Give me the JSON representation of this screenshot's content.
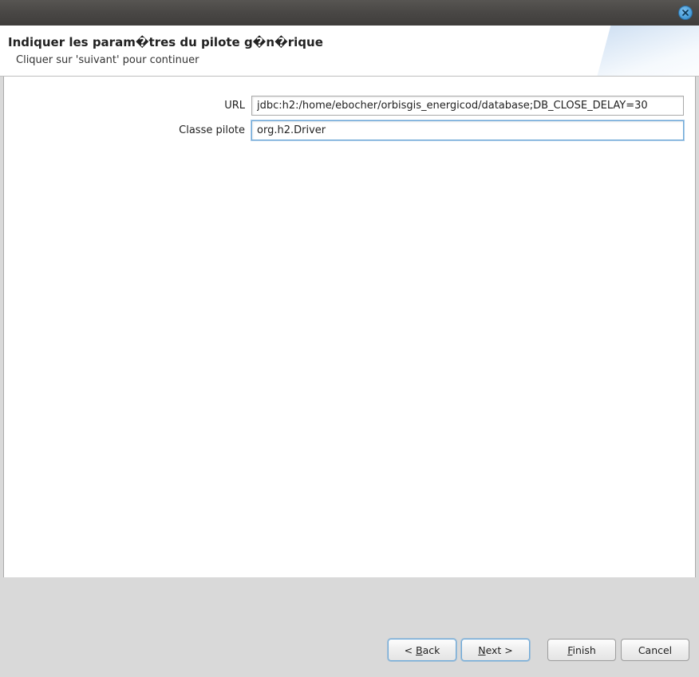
{
  "header": {
    "title": "Indiquer les param�tres du pilote g�n�rique",
    "subtitle": "Cliquer sur 'suivant' pour continuer"
  },
  "form": {
    "url_label": "URL",
    "url_value": "jdbc:h2:/home/ebocher/orbisgis_energicod/database;DB_CLOSE_DELAY=30",
    "driver_class_label": "Classe pilote",
    "driver_class_value": "org.h2.Driver"
  },
  "buttons": {
    "back_prefix": "< ",
    "back_mnemonic": "B",
    "back_suffix": "ack",
    "next_mnemonic": "N",
    "next_suffix": "ext >",
    "finish_mnemonic": "F",
    "finish_suffix": "inish",
    "cancel": "Cancel"
  }
}
